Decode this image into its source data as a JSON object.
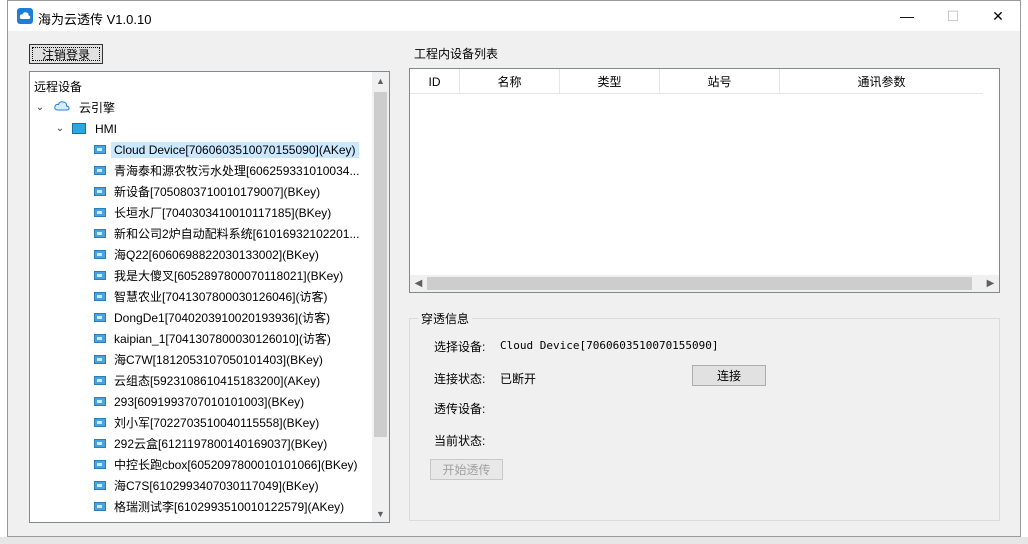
{
  "window": {
    "title": "海为云透传 V1.0.10",
    "controls": {
      "minimize": "—",
      "maximize": "☐",
      "close": "✕"
    }
  },
  "toolbar": {
    "logout_label": "注销登录"
  },
  "tree": {
    "header": "远程设备",
    "root": {
      "label": "云引擎",
      "expanded": true
    },
    "group": {
      "label": "HMI",
      "expanded": true
    },
    "devices": [
      {
        "label": "Cloud Device[7060603510070155090](AKey)",
        "selected": true
      },
      {
        "label": "青海泰和源农牧污水处理[606259331010034..."
      },
      {
        "label": "新设备[7050803710010179007](BKey)"
      },
      {
        "label": "长垣水厂[7040303410010117185](BKey)"
      },
      {
        "label": "新和公司2炉自动配料系统[61016932102201..."
      },
      {
        "label": "海Q22[6060698822030133002](BKey)"
      },
      {
        "label": "我是大傻叉[6052897800070118021](BKey)"
      },
      {
        "label": "智慧农业[7041307800030126046](访客)"
      },
      {
        "label": "DongDe1[7040203910020193936](访客)"
      },
      {
        "label": "kaipian_1[7041307800030126010](访客)"
      },
      {
        "label": "海C7W[1812053107050101403](BKey)"
      },
      {
        "label": "云组态[5923108610415183200](AKey)"
      },
      {
        "label": "293[6091993707010101003](BKey)"
      },
      {
        "label": "刘小军[7022703510040115558](BKey)"
      },
      {
        "label": "292云盒[6121197800140169037](BKey)"
      },
      {
        "label": "中控长跑cbox[6052097800010101066](BKey)"
      },
      {
        "label": "海C7S[6102993407030117049](BKey)"
      },
      {
        "label": "格瑞测试李[6102993510010122579](AKey)"
      }
    ]
  },
  "device_list": {
    "title": "工程内设备列表",
    "columns": [
      "ID",
      "名称",
      "类型",
      "站号",
      "通讯参数"
    ]
  },
  "penetration": {
    "title": "穿透信息",
    "selected_device_label": "选择设备:",
    "selected_device_value": "Cloud Device[7060603510070155090]",
    "connection_status_label": "连接状态:",
    "connection_status_value": "已断开",
    "connect_button": "连接",
    "transparent_device_label": "透传设备:",
    "current_status_label": "当前状态:",
    "start_button": "开始透传"
  },
  "colors": {
    "selection": "#cce8ff",
    "window_bg": "#f0f0f0",
    "app_icon": "#1b7fd6"
  }
}
